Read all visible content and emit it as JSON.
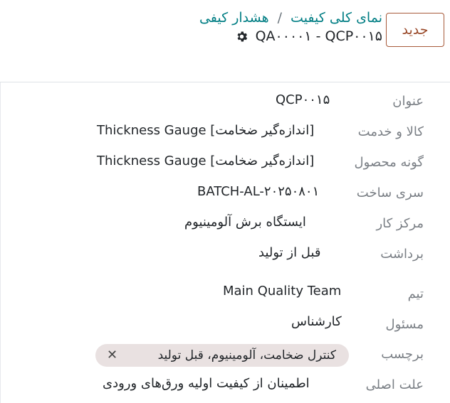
{
  "control_panel": {
    "new_button": "جدید",
    "breadcrumb": [
      "نمای کلی کیفیت",
      "هشدار کیفی"
    ],
    "breadcrumb_sep": "/",
    "record_title": "QA۰۰۰۰۱ - QCP۰۰۱۵"
  },
  "form": {
    "fields": [
      {
        "label": "عنوان",
        "value": "QCP۰۰۱۵"
      },
      {
        "label": "کالا و خدمت",
        "value": "Thickness Gauge [اندازه‌گیر ضخامت]"
      },
      {
        "label": "گونه محصول",
        "value": "Thickness Gauge [اندازه‌گیر ضخامت]"
      },
      {
        "label": "سری ساخت",
        "value": "BATCH-AL-۲۰۲۵۰۸۰۱"
      },
      {
        "label": "مرکز کار",
        "value": "ایستگاه برش آلومینیوم"
      },
      {
        "label": "برداشت",
        "value": "قبل از تولید"
      },
      {
        "label": "تیم",
        "value": "Main Quality Team"
      },
      {
        "label": "مسئول",
        "value": "کارشناس"
      },
      {
        "label": "برچسب",
        "value": "کنترل ضخامت، آلومینیوم، قبل تولید"
      },
      {
        "label": "علت اصلی",
        "value": "اطمینان از کیفیت اولیه ورق‌های ورودی"
      }
    ],
    "tag_remove": "✕"
  },
  "icons": {
    "settings": "gear-icon",
    "remove_tag": "close-icon"
  },
  "colors": {
    "link": "#017e84",
    "new_button": "#9a4a2a",
    "tag_bg": "#e9e1e1",
    "label": "#7a7f85"
  }
}
